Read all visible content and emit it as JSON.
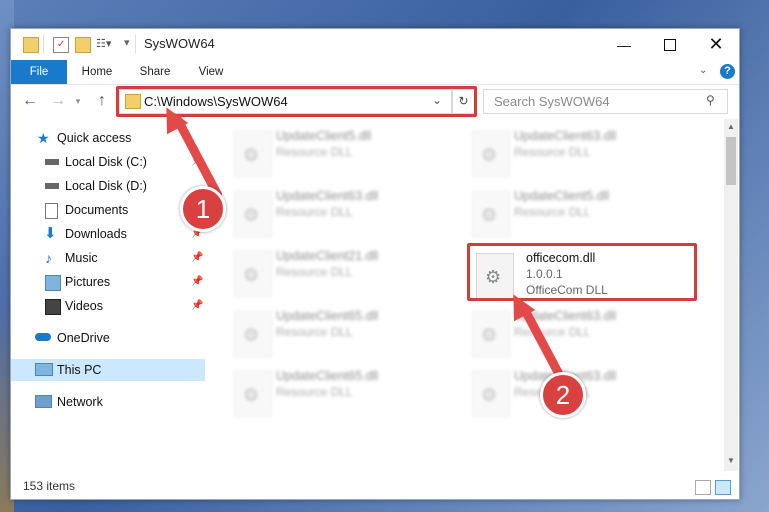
{
  "window": {
    "title": "SysWOW64",
    "ribbon_tabs": [
      "File",
      "Home",
      "Share",
      "View"
    ]
  },
  "address": {
    "path": "C:\\Windows\\SysWOW64",
    "search_placeholder": "Search SysWOW64"
  },
  "sidebar": {
    "items": [
      {
        "label": "Quick access",
        "icon": "star-icon",
        "pinned": false
      },
      {
        "label": "Local Disk (C:)",
        "icon": "drive-icon",
        "pinned": true
      },
      {
        "label": "Local Disk (D:)",
        "icon": "drive-icon",
        "pinned": false
      },
      {
        "label": "Documents",
        "icon": "document-icon",
        "pinned": true
      },
      {
        "label": "Downloads",
        "icon": "download-icon",
        "pinned": true
      },
      {
        "label": "Music",
        "icon": "music-icon",
        "pinned": true
      },
      {
        "label": "Pictures",
        "icon": "pictures-icon",
        "pinned": true
      },
      {
        "label": "Videos",
        "icon": "video-icon",
        "pinned": true
      },
      {
        "label": "OneDrive",
        "icon": "cloud-icon",
        "pinned": false
      },
      {
        "label": "This PC",
        "icon": "pc-icon",
        "pinned": false
      },
      {
        "label": "Network",
        "icon": "network-icon",
        "pinned": false
      }
    ]
  },
  "files": {
    "left": [
      {
        "name": "UpdateClient5.dll",
        "desc": "Resource DLL"
      },
      {
        "name": "UpdateClient63.dll",
        "desc": "Resource DLL"
      },
      {
        "name": "UpdateClient21.dll",
        "desc": "Resource DLL"
      },
      {
        "name": "UpdateClient65.dll",
        "desc": "Resource DLL"
      },
      {
        "name": "UpdateClient65.dll",
        "desc": "Resource DLL"
      }
    ],
    "right": [
      {
        "name": "UpdateClient63.dll",
        "desc": "Resource DLL"
      },
      {
        "name": "UpdateClient5.dll",
        "desc": "Resource DLL"
      },
      {
        "name": "UpdateClient63.dll",
        "desc": "Resource DLL"
      },
      {
        "name": "UpdateClient63.dll",
        "desc": "Resource DLL"
      }
    ],
    "target": {
      "name": "officecom.dll",
      "version": "1.0.0.1",
      "desc": "OfficeCom DLL"
    }
  },
  "status": {
    "count": "153 items"
  },
  "callouts": {
    "step1": "1",
    "step2": "2"
  },
  "colors": {
    "accent": "#1979ca",
    "highlight": "#d43d3d",
    "selected": "#cce8ff"
  }
}
